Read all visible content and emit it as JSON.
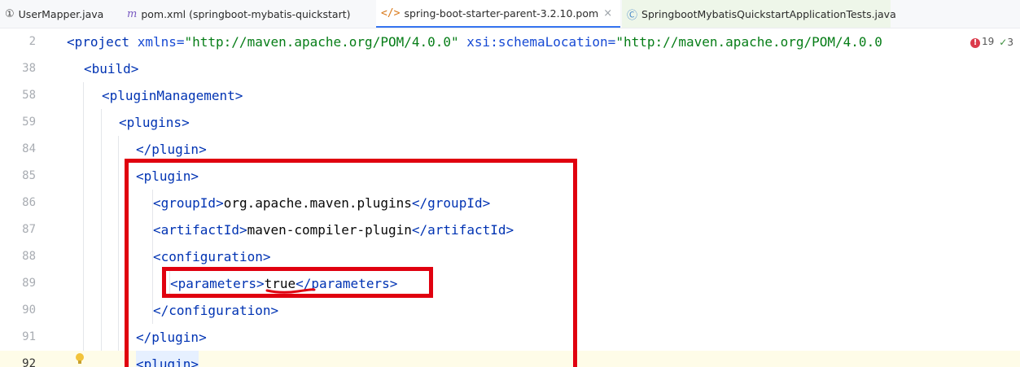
{
  "tabs": [
    {
      "label": "UserMapper.java",
      "icon": "interface-icon"
    },
    {
      "label": "pom.xml (springboot-mybatis-quickstart)",
      "icon": "maven-icon"
    },
    {
      "label": "spring-boot-starter-parent-3.2.10.pom",
      "icon": "xml-icon",
      "close": "×"
    },
    {
      "label": "SpringbootMybatisQuickstartApplicationTests.java",
      "icon": "test-class-icon"
    }
  ],
  "inspections": {
    "errors": "19",
    "checks": "3"
  },
  "lines": {
    "l2": {
      "num": "2",
      "tag_open": "<project",
      "attr1": " xmlns=",
      "val1": "\"http://maven.apache.org/POM/4.0.0\"",
      "attr2": " xsi:schemaLocation=",
      "val2": "\"http://maven.apache.org/POM/4.0.0"
    },
    "l38": {
      "num": "38",
      "text": "<build>"
    },
    "l58": {
      "num": "58",
      "text": "<pluginManagement>"
    },
    "l59": {
      "num": "59",
      "text": "<plugins>"
    },
    "l84": {
      "num": "84",
      "text": "</plugin>"
    },
    "l85": {
      "num": "85",
      "text": "<plugin>"
    },
    "l86": {
      "num": "86",
      "open": "<groupId>",
      "value": "org.apache.maven.plugins",
      "close": "</groupId>"
    },
    "l87": {
      "num": "87",
      "open": "<artifactId>",
      "value": "maven-compiler-plugin",
      "close": "</artifactId>"
    },
    "l88": {
      "num": "88",
      "text": "<configuration>"
    },
    "l89": {
      "num": "89",
      "open": "<parameters>",
      "value": "true",
      "close": "</parameters>"
    },
    "l90": {
      "num": "90",
      "text": "</configuration>"
    },
    "l91": {
      "num": "91",
      "text": "</plugin>"
    },
    "l92": {
      "num": "92",
      "text": "<plugin>"
    }
  },
  "colors": {
    "tag": "#0033b3",
    "attribute": "#174ad4",
    "string": "#067d17",
    "highlight_box": "#e0000f",
    "active_tab_underline": "#3574f0"
  }
}
